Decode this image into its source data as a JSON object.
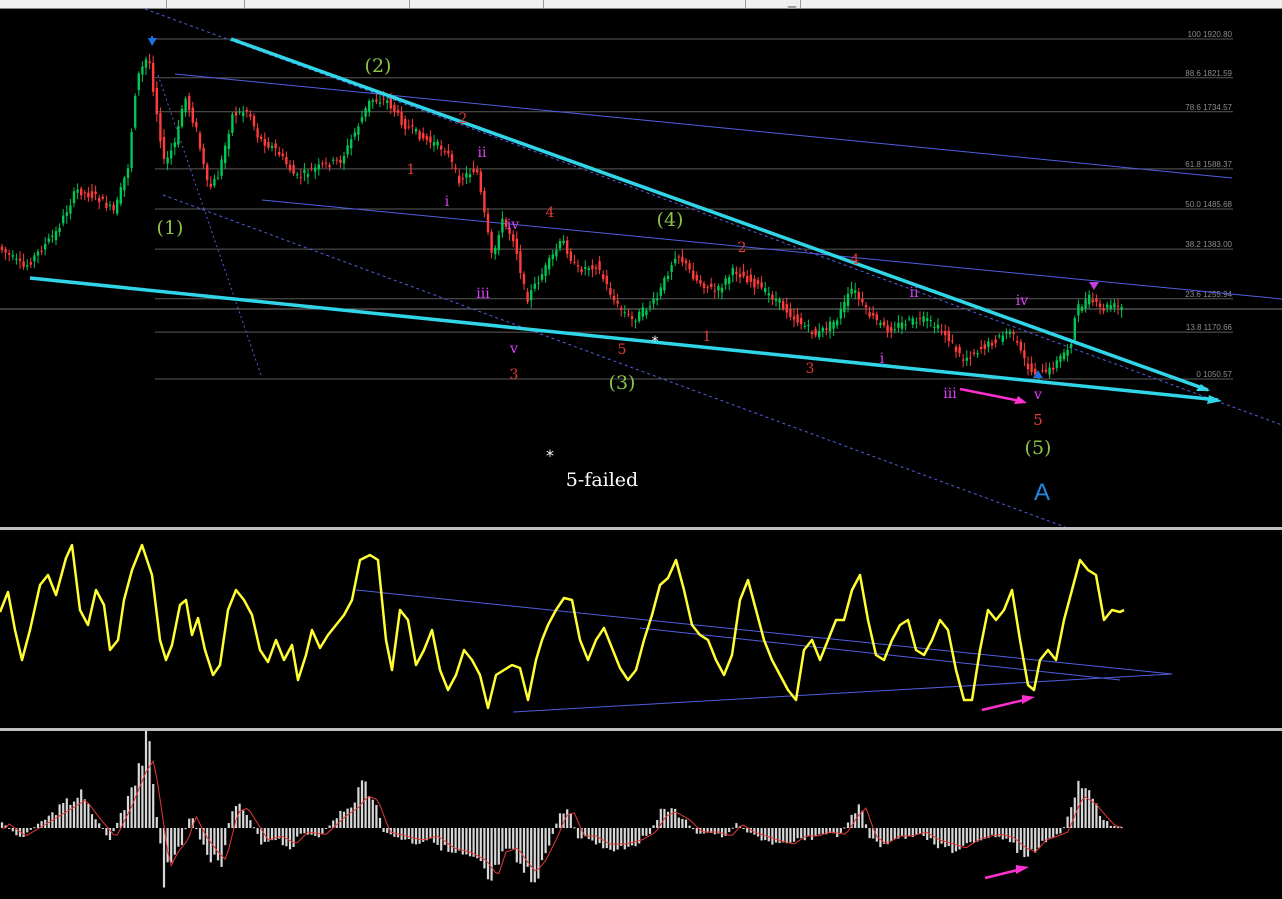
{
  "chart_data": [
    {
      "type": "candlestick",
      "fib_levels": [
        {
          "pct": "100",
          "price": "1920.80"
        },
        {
          "pct": "88.6",
          "price": "1821.59"
        },
        {
          "pct": "78.6",
          "price": "1734.57"
        },
        {
          "pct": "61.8",
          "price": "1588.37"
        },
        {
          "pct": "50.0",
          "price": "1485.68"
        },
        {
          "pct": "38.2",
          "price": "1383.00"
        },
        {
          "pct": "23.6",
          "price": "1255.94"
        },
        {
          "pct": "13.8",
          "price": "1170.66"
        },
        {
          "pct": "0",
          "price": "1050.57"
        }
      ],
      "annotations": {
        "intermediate_waves": [
          "(1)",
          "(2)",
          "(3)",
          "(4)",
          "(5)"
        ],
        "minor_waves": [
          "1",
          "2",
          "3",
          "4",
          "5",
          "1",
          "2",
          "3",
          "4",
          "5",
          "1",
          "2",
          "3",
          "4",
          "5"
        ],
        "minute_waves": [
          "i",
          "ii",
          "iii",
          "iv",
          "v",
          "i",
          "ii",
          "iii",
          "iv",
          "v"
        ],
        "cycle_label": "A",
        "note": "5-failed",
        "asterisks": [
          "*",
          "*"
        ]
      },
      "colors": {
        "wave_intermediate": "#8bc34a",
        "wave_minor": "#e53935",
        "wave_minute": "#e040fb",
        "cycle": "#1e88e5",
        "trendline": "#30d5e8",
        "channel": "#4f5fe0",
        "divergence_arrow": "#ff2fd0",
        "candle_up": "#00c853",
        "candle_down": "#ff3b3b"
      }
    },
    {
      "type": "line",
      "series": [
        {
          "color": "#ffff33"
        }
      ]
    },
    {
      "type": "histogram",
      "series": [
        {
          "color": "#d8d8d8"
        },
        {
          "color": "#e53935"
        }
      ]
    }
  ]
}
